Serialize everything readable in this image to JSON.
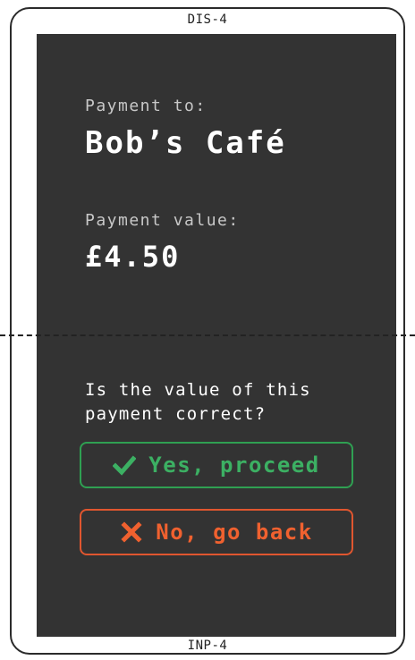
{
  "device": {
    "top_label": "DIS-4",
    "bottom_label": "INP-4"
  },
  "payment": {
    "payee_caption": "Payment to:",
    "payee_name": "Bob’s Café",
    "amount_caption": "Payment value:",
    "amount": "£4.50"
  },
  "confirm": {
    "question": "Is the value of this payment correct?",
    "yes_label": "Yes, proceed",
    "no_label": "No, go back"
  },
  "colors": {
    "screen_bg": "#333333",
    "yes_accent": "#3cb063",
    "no_accent": "#f0612f"
  },
  "icons": {
    "yes_icon": "check-icon",
    "no_icon": "cross-icon"
  }
}
